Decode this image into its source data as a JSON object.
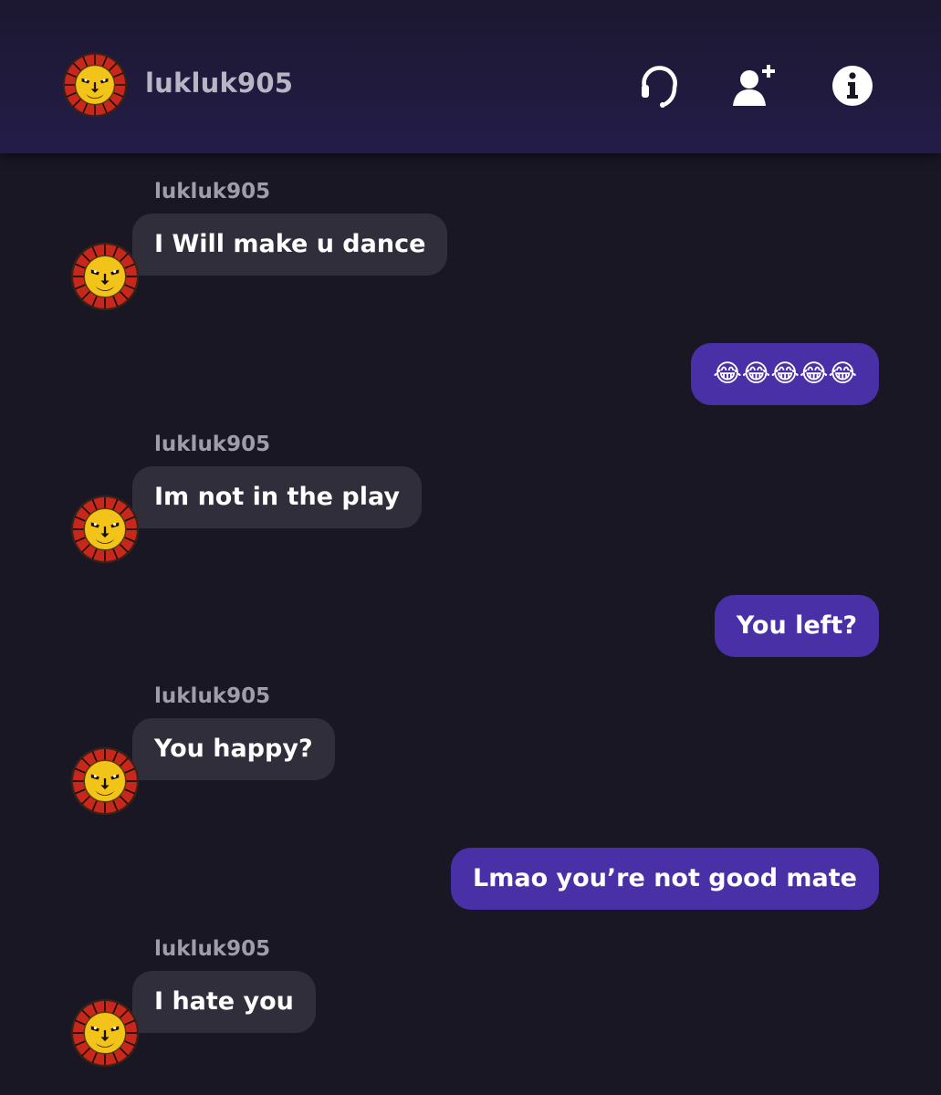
{
  "header": {
    "username": "lukluk905",
    "icons": [
      "headset-icon",
      "add-friend-icon",
      "info-icon"
    ]
  },
  "colors": {
    "background": "#191724",
    "incoming_bubble": "#312e3c",
    "outgoing_bubble": "#4a30a6",
    "sender_name": "#9f9daa"
  },
  "messages": [
    {
      "direction": "incoming",
      "sender": "lukluk905",
      "text": "I Will make u dance"
    },
    {
      "direction": "outgoing",
      "text": "😂😂😂😂😂"
    },
    {
      "direction": "incoming",
      "sender": "lukluk905",
      "text": "Im not in the play"
    },
    {
      "direction": "outgoing",
      "text": "You left?"
    },
    {
      "direction": "incoming",
      "sender": "lukluk905",
      "text": "You happy?"
    },
    {
      "direction": "outgoing",
      "text": "Lmao you’re not good mate"
    },
    {
      "direction": "incoming",
      "sender": "lukluk905",
      "text": "I hate you"
    }
  ]
}
